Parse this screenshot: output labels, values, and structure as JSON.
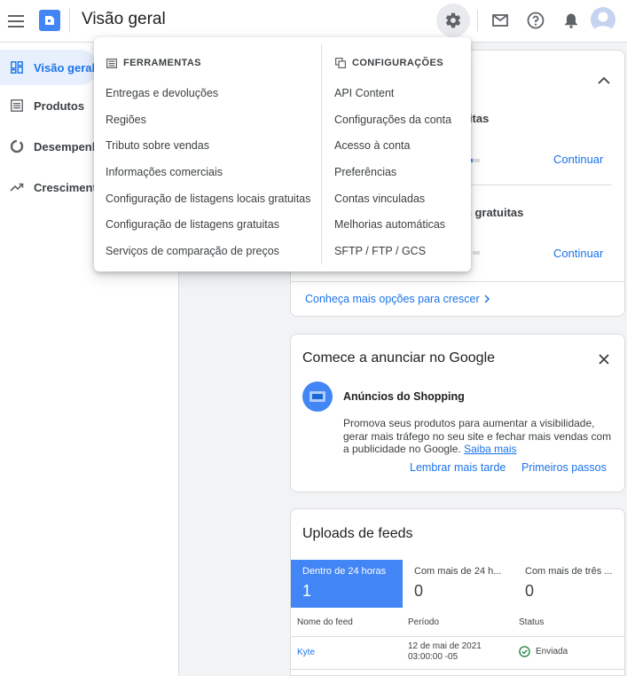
{
  "header": {
    "title": "Visão geral"
  },
  "sidebar": {
    "items": [
      {
        "label": "Visão geral"
      },
      {
        "label": "Produtos"
      },
      {
        "label": "Desempenho"
      },
      {
        "label": "Crescimento"
      }
    ]
  },
  "settings_menu": {
    "tools_header": "FERRAMENTAS",
    "tools": [
      "Entregas e devoluções",
      "Regiões",
      "Tributo sobre vendas",
      "Informações comerciais",
      "Configuração de listagens locais gratuitas",
      "Configuração de listagens gratuitas",
      "Serviços de comparação de preços"
    ],
    "config_header": "CONFIGURAÇÕES",
    "config": [
      "API Content",
      "Configurações da conta",
      "Acesso à conta",
      "Preferências",
      "Contas vinculadas",
      "Melhorias automáticas",
      "SFTP / FTP / GCS"
    ]
  },
  "growth_card": {
    "row1_title_visible": "uitas",
    "row2_title_visible": "is gratuitas",
    "continue_label": "Continuar",
    "more_link": "Conheça mais opções para crescer"
  },
  "ads_card": {
    "title": "Comece a anunciar no Google",
    "subtitle": "Anúncios do Shopping",
    "body": "Promova seus produtos para aumentar a visibilidade, gerar mais tráfego no seu site e fechar mais vendas com a publicidade no Google.",
    "learn_more": "Saiba mais",
    "remind_later": "Lembrar mais tarde",
    "first_steps": "Primeiros passos"
  },
  "feeds_card": {
    "title": "Uploads de feeds",
    "tabs": [
      {
        "label": "Dentro de 24 horas",
        "count": "1"
      },
      {
        "label": "Com mais de 24 h...",
        "count": "0"
      },
      {
        "label": "Com mais de três ...",
        "count": "0"
      }
    ],
    "columns": [
      "Nome do feed",
      "Período",
      "Status"
    ],
    "rows": [
      {
        "name": "Kyte",
        "period_line1": "12 de mai de 2021",
        "period_line2": "03:00:00 -05",
        "status": "Enviada"
      }
    ]
  },
  "colors": {
    "accent": "#1a73e8",
    "tab_active": "#4285f4",
    "success": "#188038"
  }
}
